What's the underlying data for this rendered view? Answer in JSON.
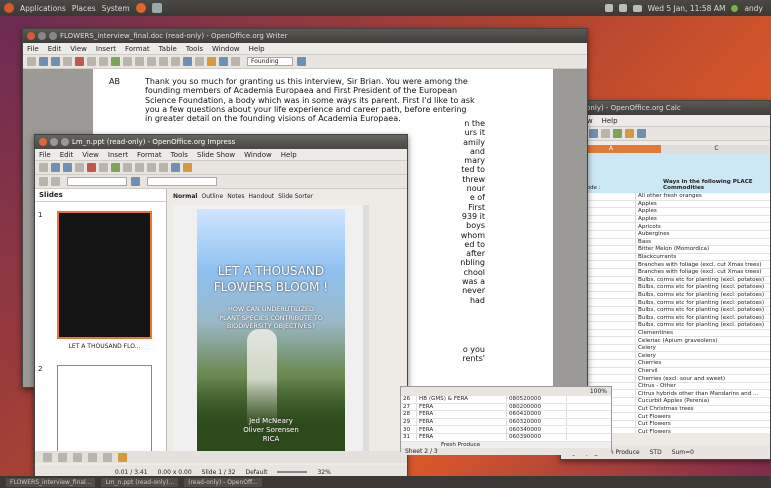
{
  "top_panel": {
    "menus": [
      "Applications",
      "Places",
      "System"
    ],
    "clock": "Wed 5 Jan, 11:58 AM",
    "user": "andy"
  },
  "writer": {
    "title": "FLOWERS_interview_final.doc (read-only) - OpenOffice.org Writer",
    "menus": [
      "File",
      "Edit",
      "View",
      "Insert",
      "Format",
      "Table",
      "Tools",
      "Window",
      "Help"
    ],
    "style_box": "Founding",
    "paragraph_label": "AB",
    "paragraph": "Thank you so much for granting us this interview, Sir Brian. You were among the founding members of Academia Europaea and First President of the European Science Foundation, a body which was in some ways its parent. First I'd like to ask you a few questions about your life experience and career path, before entering in greater detail on the founding visions of Academia Europaea.",
    "right_fragments": [
      "n the",
      "urs it",
      "amily",
      "and",
      "mary",
      "ted to",
      "threw",
      "nour",
      "e of",
      "First",
      "939 it",
      "boys",
      "whom",
      "ed to",
      "after",
      "nbling",
      "chool",
      "was a",
      "never",
      "had",
      "o you",
      "rents'"
    ]
  },
  "impress": {
    "title": "Lm_n.ppt (read-only) - OpenOffice.org Impress",
    "menus": [
      "File",
      "Edit",
      "View",
      "Insert",
      "Format",
      "Tools",
      "Slide Show",
      "Window",
      "Help"
    ],
    "slides_header": "Slides",
    "tabs": [
      "Normal",
      "Outline",
      "Notes",
      "Handout",
      "Slide Sorter"
    ],
    "slide1_caption": "LET A THOUSAND FLO...",
    "slide_numbers": [
      "1",
      "2"
    ],
    "slide_title": "LET A THOUSAND FLOWERS BLOOM !",
    "slide_subtitle": "HOW CAN UNDERUTILIZED PLANT SPECIES CONTRIBUTE TO BIODIVERSITY OBJECTIVES?",
    "slide_authors": "Jed McNeary\nOliver Sorensen\nRICA",
    "status_position": "0.01 / 3.41",
    "status_size": "0.00 x 0.00",
    "status_slide": "Slide 1 / 32",
    "status_layout": "Default",
    "status_zoom": "32%"
  },
  "calc": {
    "title": "(read-only) - OpenOffice.org Calc",
    "menus": [
      "Window",
      "Help"
    ],
    "col_a": "A",
    "col_c": "C",
    "col_header_left": "(code) Code :",
    "col_header_right": "Ways in the following PLACE Commodities",
    "rows": [
      "All other fresh oranges",
      "Apples",
      "Apples",
      "Apples",
      "Apricots",
      "Aubergines",
      "Bass",
      "Bitter Melon (Momordica)",
      "Blackcurrants",
      "Branches with foliage (excl. cut Xmas trees)",
      "Branches with foliage (excl. cut Xmas trees)",
      "Bulbs, corms etc for planting (excl. potatoes)",
      "Bulbs, corms etc for planting (excl. potatoes)",
      "Bulbs, corms etc for planting (excl. potatoes)",
      "Bulbs, corms etc for planting (excl. potatoes)",
      "Bulbs, corms etc for planting (excl. potatoes)",
      "Bulbs, corms etc for planting (excl. potatoes)",
      "Bulbs, corms etc for planting (excl. potatoes)",
      "Clementines",
      "Celeriac (Apium graveolens)",
      "Celery",
      "Celery",
      "Cherries",
      "Chervil",
      "Cherries (excl. sour and sweet)",
      "Citrus - Other",
      "Citrus hybrids other than Mandarins and ...",
      "Cucurbit Apples (Perenia)",
      "Cut Christmas trees",
      "Cut Flowers",
      "Cut Flowers",
      "Cut Flowers"
    ],
    "lower_rows": [
      {
        "num": "26",
        "name": "HB (GMS) & FERA",
        "code": "080520000"
      },
      {
        "num": "27",
        "name": "FERA",
        "code": "080200000"
      },
      {
        "num": "28",
        "name": "FERA",
        "code": "060410000"
      },
      {
        "num": "29",
        "name": "FERA",
        "code": "060320000"
      },
      {
        "num": "30",
        "name": "FERA",
        "code": "060340000"
      },
      {
        "num": "31",
        "name": "FERA",
        "code": "060390000"
      }
    ],
    "sheet_tab": "Fresh Produce",
    "zoom": "100%",
    "status_sheet": "Sheet 2 / 3",
    "status_style": "PageStyle_Fresh Produce",
    "status_mode": "STD",
    "status_sum": "Sum=0"
  },
  "taskbar": {
    "items": [
      "FLOWERS_interview_final...",
      "Lm_n.ppt (read-only)...",
      "(read-only) - OpenOff..."
    ]
  },
  "colors": {
    "desktop_accent": "#d9582a",
    "panel": "#3a3935",
    "slide_selection": "#e7772d"
  }
}
